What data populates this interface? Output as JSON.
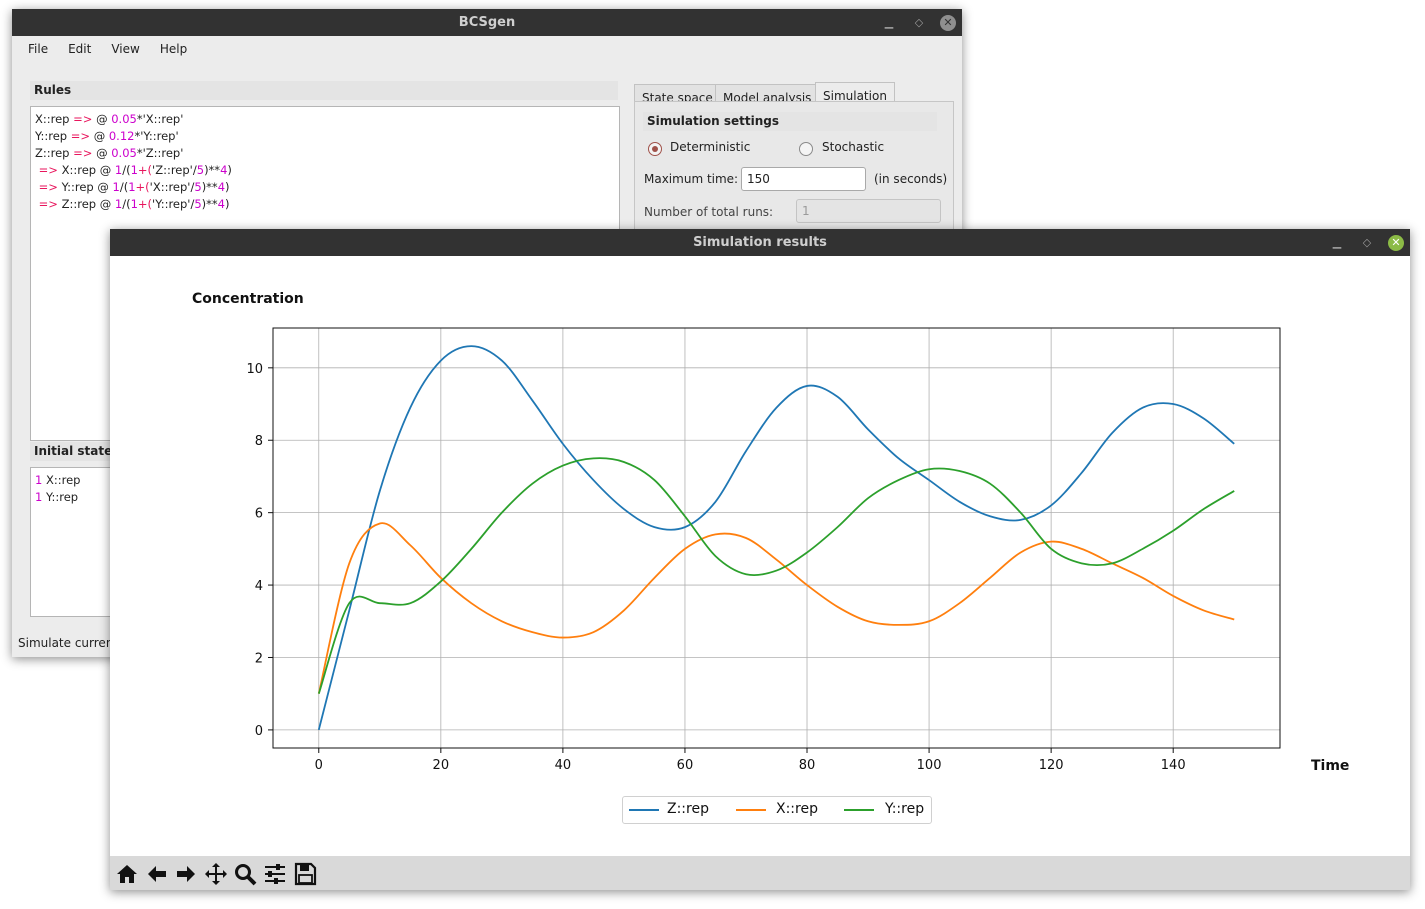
{
  "main_window": {
    "title": "BCSgen",
    "menu": [
      "File",
      "Edit",
      "View",
      "Help"
    ],
    "rules_title": "Rules",
    "rules": [
      {
        "pre": "X::rep ",
        "arrow": "=>",
        "mid": " @ ",
        "rate": "0.05",
        "post": "*'X::rep'"
      },
      {
        "pre": "Y::rep ",
        "arrow": "=>",
        "mid": " @ ",
        "rate": "0.12",
        "post": "*'Y::rep'"
      },
      {
        "pre": "Z::rep ",
        "arrow": "=>",
        "mid": " @ ",
        "rate": "0.05",
        "post": "*'Z::rep'"
      }
    ],
    "rules_hill": [
      {
        "target": " X::rep @ ",
        "inhib": "'Z::rep'"
      },
      {
        "target": " Y::rep @ ",
        "inhib": "'X::rep'"
      },
      {
        "target": " Z::rep @ ",
        "inhib": "'Y::rep'"
      }
    ],
    "hill_parts": {
      "arrow": "=>",
      "one": "1",
      "slash": "/(",
      "one2": "1",
      "plus": "+(",
      "div": "/",
      "five": "5",
      "close": ")**",
      "exp": "4",
      "end": ")"
    },
    "initial_state_title": "Initial state",
    "initial_state": [
      {
        "count": "1",
        "agent": " X::rep"
      },
      {
        "count": "1",
        "agent": " Y::rep"
      }
    ],
    "status_text": "Simulate current",
    "tabs": [
      "State space",
      "Model analysis",
      "Simulation"
    ],
    "active_tab": "Simulation",
    "simulation_settings": {
      "title": "Simulation settings",
      "deterministic_label": "Deterministic",
      "stochastic_label": "Stochastic",
      "selected_mode": "Deterministic",
      "max_time_label": "Maximum time:",
      "max_time_value": "150",
      "max_time_unit": "(in seconds)",
      "runs_label": "Number of total runs:",
      "runs_value": "1"
    }
  },
  "results_window": {
    "title": "Simulation results",
    "toolbar": [
      "home-icon",
      "back-icon",
      "forward-icon",
      "pan-icon",
      "zoom-icon",
      "configure-subplots-icon",
      "save-icon"
    ]
  },
  "chart_data": {
    "type": "line",
    "title": "",
    "xlabel": "Time",
    "ylabel": "Concentration",
    "xlim": [
      -7.5,
      157.5
    ],
    "ylim": [
      -0.5,
      11.1
    ],
    "xticks": [
      0,
      20,
      40,
      60,
      80,
      100,
      120,
      140
    ],
    "yticks": [
      0,
      2,
      4,
      6,
      8,
      10
    ],
    "grid": true,
    "legend_position": "bottom-center",
    "colors": {
      "Z::rep": "#1f77b4",
      "X::rep": "#ff7f0e",
      "Y::rep": "#2ca02c"
    },
    "series": [
      {
        "name": "Z::rep",
        "x": [
          0,
          5,
          10,
          15,
          20,
          25,
          30,
          35,
          40,
          45,
          50,
          55,
          60,
          65,
          70,
          75,
          80,
          85,
          90,
          95,
          100,
          105,
          110,
          115,
          120,
          125,
          130,
          135,
          140,
          145,
          150
        ],
        "y": [
          0,
          3.3,
          6.6,
          8.9,
          10.2,
          10.6,
          10.2,
          9.1,
          7.9,
          6.9,
          6.1,
          5.6,
          5.6,
          6.3,
          7.7,
          8.9,
          9.5,
          9.2,
          8.3,
          7.5,
          6.9,
          6.3,
          5.9,
          5.8,
          6.2,
          7.1,
          8.2,
          8.9,
          9.0,
          8.6,
          7.9
        ]
      },
      {
        "name": "X::rep",
        "x": [
          0,
          5,
          10,
          15,
          20,
          25,
          30,
          35,
          40,
          45,
          50,
          55,
          60,
          65,
          70,
          75,
          80,
          85,
          90,
          95,
          100,
          105,
          110,
          115,
          120,
          125,
          130,
          135,
          140,
          145,
          150
        ],
        "y": [
          1,
          4.6,
          5.7,
          5.1,
          4.2,
          3.5,
          3.0,
          2.7,
          2.55,
          2.7,
          3.3,
          4.2,
          5.0,
          5.4,
          5.3,
          4.7,
          4.0,
          3.4,
          3.0,
          2.9,
          3.0,
          3.5,
          4.2,
          4.9,
          5.2,
          5.0,
          4.6,
          4.2,
          3.7,
          3.3,
          3.05
        ]
      },
      {
        "name": "Y::rep",
        "x": [
          0,
          5,
          10,
          15,
          20,
          25,
          30,
          35,
          40,
          45,
          50,
          55,
          60,
          65,
          70,
          75,
          80,
          85,
          90,
          95,
          100,
          105,
          110,
          115,
          120,
          125,
          130,
          135,
          140,
          145,
          150
        ],
        "y": [
          1,
          3.5,
          3.5,
          3.5,
          4.1,
          5.0,
          6.0,
          6.8,
          7.3,
          7.5,
          7.4,
          6.9,
          5.9,
          4.8,
          4.3,
          4.4,
          4.9,
          5.6,
          6.4,
          6.9,
          7.2,
          7.15,
          6.8,
          6.0,
          5.0,
          4.6,
          4.6,
          5.0,
          5.5,
          6.1,
          6.6
        ]
      }
    ]
  }
}
